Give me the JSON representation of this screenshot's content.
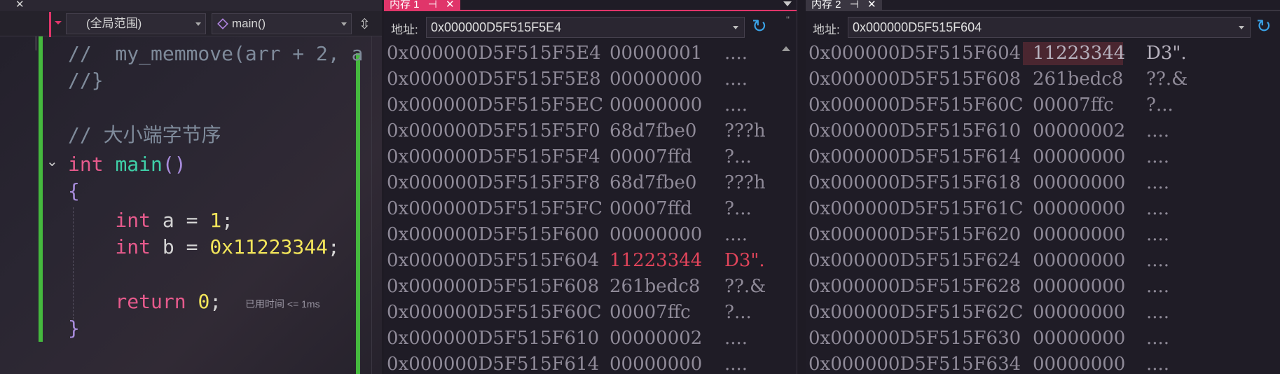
{
  "editor": {
    "scope_dropdown": "(全局范围)",
    "function_dropdown": "main()",
    "lines": [
      {
        "tokens": [
          {
            "t": "//  my_memmove(arr + 2, a",
            "c": "cm"
          }
        ]
      },
      {
        "tokens": [
          {
            "t": "//}",
            "c": "cm"
          }
        ]
      },
      {
        "tokens": []
      },
      {
        "tokens": [
          {
            "t": "// 大小端字节序",
            "c": "cm"
          }
        ]
      },
      {
        "tokens": [
          {
            "t": "int",
            "c": "kw"
          },
          {
            "t": " ",
            "c": "pl"
          },
          {
            "t": "main",
            "c": "fn"
          },
          {
            "t": "()",
            "c": "br"
          }
        ]
      },
      {
        "tokens": [
          {
            "t": "{",
            "c": "br"
          }
        ]
      },
      {
        "tokens": [
          {
            "t": "    int",
            "c": "kw"
          },
          {
            "t": " a = ",
            "c": "pl"
          },
          {
            "t": "1",
            "c": "num"
          },
          {
            "t": ";",
            "c": "pl"
          }
        ]
      },
      {
        "tokens": [
          {
            "t": "    int",
            "c": "kw"
          },
          {
            "t": " b = ",
            "c": "pl"
          },
          {
            "t": "0x11223344",
            "c": "num"
          },
          {
            "t": ";",
            "c": "pl"
          }
        ]
      },
      {
        "tokens": []
      },
      {
        "tokens": [
          {
            "t": "    return",
            "c": "kw"
          },
          {
            "t": " ",
            "c": "pl"
          },
          {
            "t": "0",
            "c": "num"
          },
          {
            "t": ";",
            "c": "pl"
          }
        ]
      },
      {
        "tokens": [
          {
            "t": "}",
            "c": "br"
          }
        ]
      }
    ],
    "elapsed_hint": "已用时间 <= 1ms"
  },
  "memory1": {
    "tab_title": "内存 1",
    "address_label": "地址:",
    "address_value": "0x000000D5F515F5E4",
    "rows": [
      {
        "addr": "0x000000D5F515F5E4",
        "hex": "00000001",
        "chars": "...."
      },
      {
        "addr": "0x000000D5F515F5E8",
        "hex": "00000000",
        "chars": "...."
      },
      {
        "addr": "0x000000D5F515F5EC",
        "hex": "00000000",
        "chars": "...."
      },
      {
        "addr": "0x000000D5F515F5F0",
        "hex": "68d7fbe0",
        "chars": "???h"
      },
      {
        "addr": "0x000000D5F515F5F4",
        "hex": "00007ffd",
        "chars": "?..."
      },
      {
        "addr": "0x000000D5F515F5F8",
        "hex": "68d7fbe0",
        "chars": "???h"
      },
      {
        "addr": "0x000000D5F515F5FC",
        "hex": "00007ffd",
        "chars": "?..."
      },
      {
        "addr": "0x000000D5F515F600",
        "hex": "00000000",
        "chars": "...."
      },
      {
        "addr": "0x000000D5F515F604",
        "hex": "11223344",
        "chars": "D3\".",
        "changed": true
      },
      {
        "addr": "0x000000D5F515F608",
        "hex": "261bedc8",
        "chars": "??.&"
      },
      {
        "addr": "0x000000D5F515F60C",
        "hex": "00007ffc",
        "chars": "?..."
      },
      {
        "addr": "0x000000D5F515F610",
        "hex": "00000002",
        "chars": "...."
      },
      {
        "addr": "0x000000D5F515F614",
        "hex": "00000000",
        "chars": "...."
      }
    ]
  },
  "memory2": {
    "tab_title": "内存 2",
    "address_label": "地址:",
    "address_value": "0x000000D5F515F604",
    "rows": [
      {
        "addr": "0x000000D5F515F604",
        "hex": "11223344",
        "chars": "D3\".",
        "selected": true
      },
      {
        "addr": "0x000000D5F515F608",
        "hex": "261bedc8",
        "chars": "??.&"
      },
      {
        "addr": "0x000000D5F515F60C",
        "hex": "00007ffc",
        "chars": "?..."
      },
      {
        "addr": "0x000000D5F515F610",
        "hex": "00000002",
        "chars": "...."
      },
      {
        "addr": "0x000000D5F515F614",
        "hex": "00000000",
        "chars": "...."
      },
      {
        "addr": "0x000000D5F515F618",
        "hex": "00000000",
        "chars": "...."
      },
      {
        "addr": "0x000000D5F515F61C",
        "hex": "00000000",
        "chars": "...."
      },
      {
        "addr": "0x000000D5F515F620",
        "hex": "00000000",
        "chars": "...."
      },
      {
        "addr": "0x000000D5F515F624",
        "hex": "00000000",
        "chars": "...."
      },
      {
        "addr": "0x000000D5F515F628",
        "hex": "00000000",
        "chars": "...."
      },
      {
        "addr": "0x000000D5F515F62C",
        "hex": "00000000",
        "chars": "...."
      },
      {
        "addr": "0x000000D5F515F630",
        "hex": "00000000",
        "chars": "...."
      },
      {
        "addr": "0x000000D5F515F634",
        "hex": "00000000",
        "chars": "...."
      }
    ]
  },
  "icons": {
    "close": "close-icon",
    "pin": "pin-icon",
    "gear": "gear-icon",
    "refresh": "refresh-icon",
    "split": "split-editor-icon",
    "fold": "chevron-down-icon"
  },
  "colors": {
    "accent": "#e0356a",
    "changed_value": "#e0445a",
    "git_change_bar": "#45b93e",
    "refresh_blue": "#3aa3e8"
  }
}
